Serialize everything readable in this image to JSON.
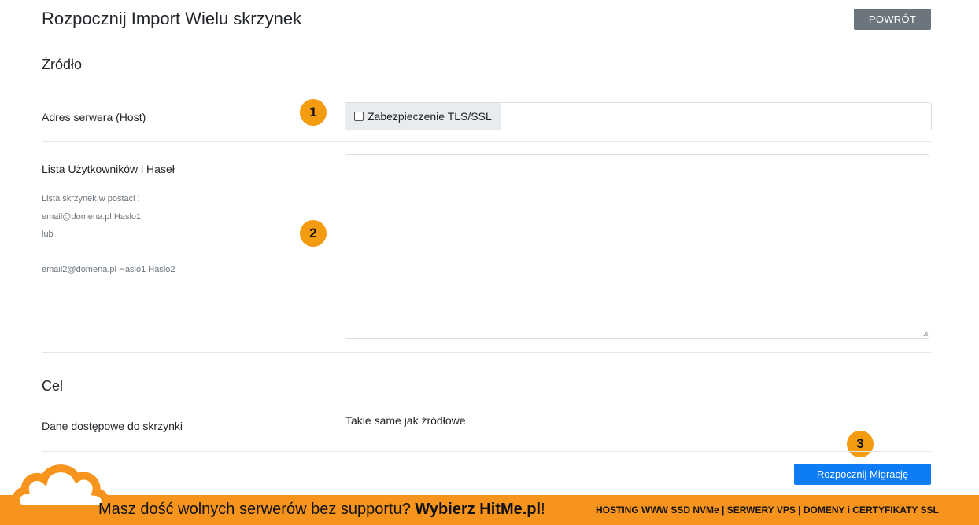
{
  "header": {
    "title": "Rozpocznij Import Wielu skrzynek",
    "back_label": "POWRÓT"
  },
  "source": {
    "section_title": "Źródło",
    "host_label": "Adres serwera (Host)",
    "tls_label": "Zabezpieczenie TLS/SSL",
    "tls_checked": false,
    "host_value": "",
    "list_label": "Lista Użytkowników i Haseł",
    "list_hint": [
      "Lista skrzynek w postaci :",
      "email@domena.pl Haslo1",
      "lub",
      "",
      "email2@domena.pl Haslo1 Haslo2"
    ],
    "list_value": ""
  },
  "target": {
    "section_title": "Cel",
    "access_label": "Dane dostępowe do skrzynki",
    "access_value": "Takie same jak źródłowe"
  },
  "actions": {
    "start_label": "Rozpocznij Migrację"
  },
  "markers": [
    "1",
    "2",
    "3"
  ],
  "banner": {
    "text_prefix": "Masz dość wolnych serwerów bez supportu? ",
    "text_bold": "Wybierz HitMe.pl",
    "text_suffix": "!",
    "right_text": "HOSTING WWW SSD NVMe | SERWERY VPS | DOMENY i CERTYFIKATY SSL"
  },
  "colors": {
    "primary": "#0d7cf5",
    "secondary": "#6c757d",
    "marker": "#f39c12",
    "banner": "#f7941d"
  }
}
